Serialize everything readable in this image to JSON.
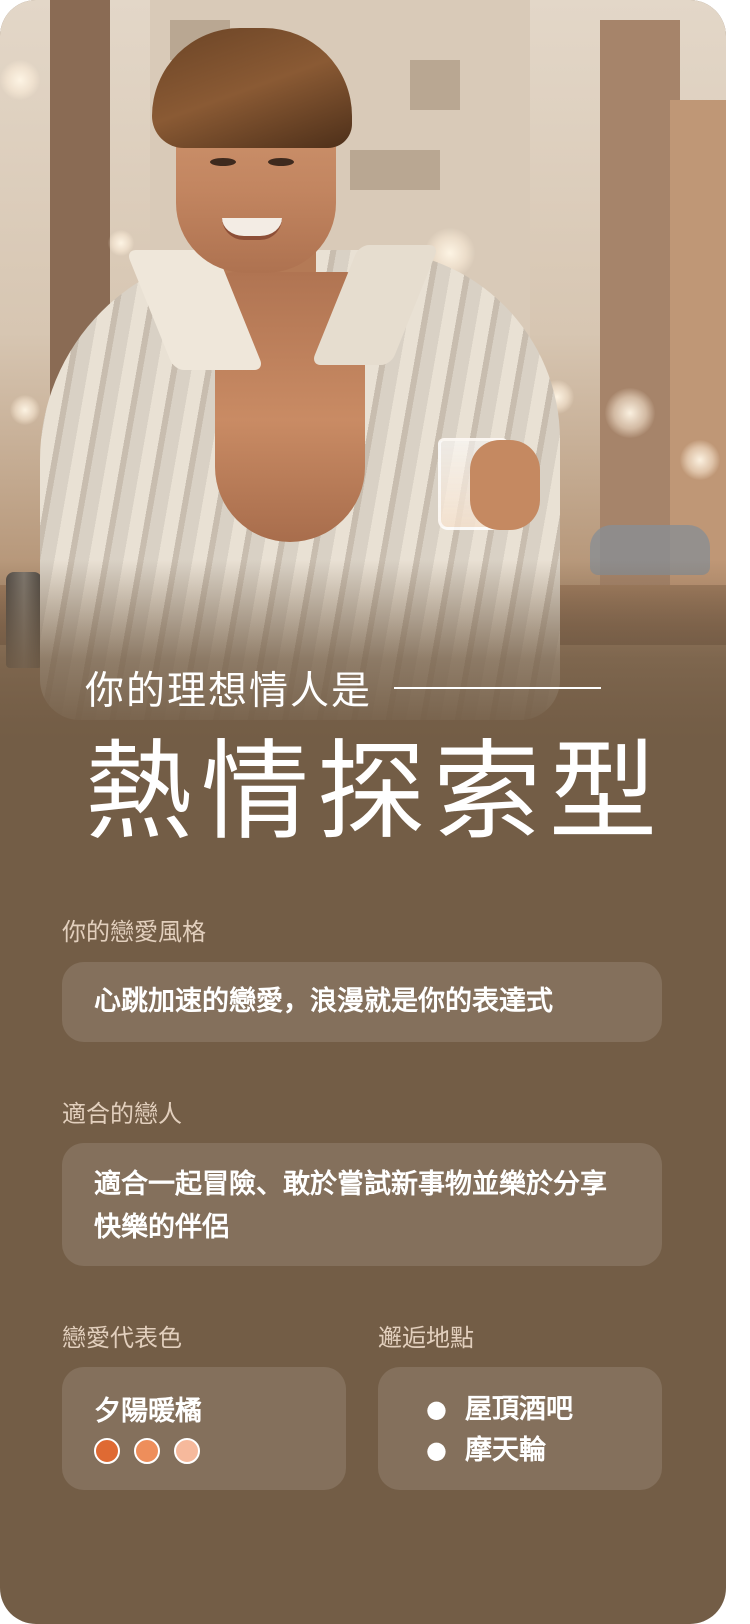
{
  "result": {
    "subtitle": "你的理想情人是",
    "title": "熱情探索型"
  },
  "love_style": {
    "label": "你的戀愛風格",
    "text": "心跳加速的戀愛，浪漫就是你的表達式"
  },
  "suitable_lover": {
    "label": "適合的戀人",
    "text": "適合一起冒險、敢於嘗試新事物並樂於分享快樂的伴侶"
  },
  "love_color": {
    "label": "戀愛代表色",
    "name": "夕陽暖橘",
    "swatches": [
      "#df6a33",
      "#ee8e5b",
      "#f6b99c"
    ]
  },
  "meeting_places": {
    "label": "邂逅地點",
    "items": [
      "屋頂酒吧",
      "摩天輪"
    ]
  },
  "colors": {
    "background": "#735d46",
    "label_text": "#e2cfbd",
    "box_fill": "rgba(255,255,255,0.12)"
  }
}
